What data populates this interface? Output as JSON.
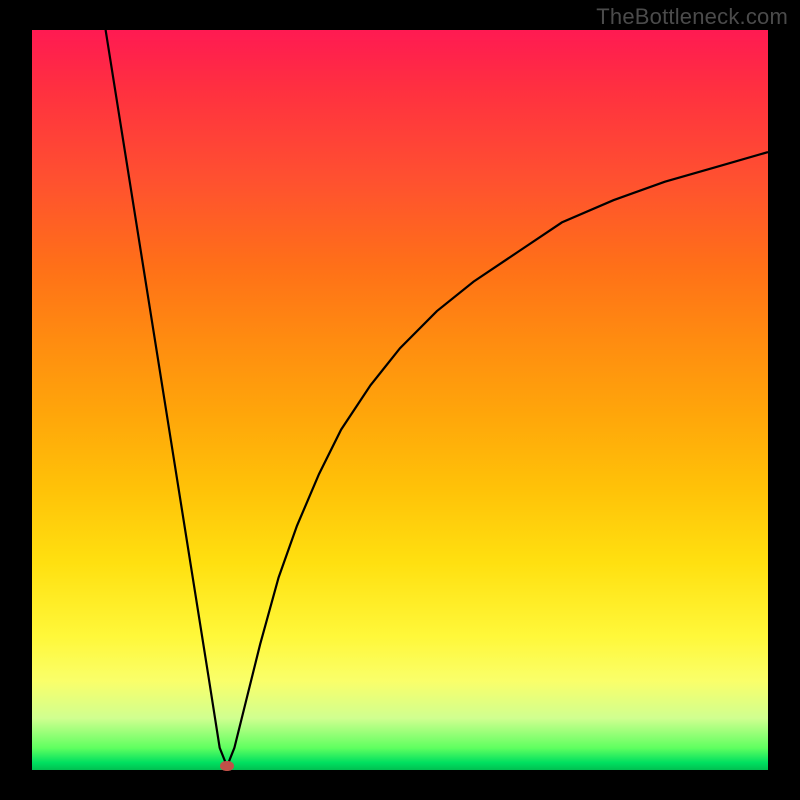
{
  "watermark": "TheBottleneck.com",
  "colors": {
    "frame": "#000000",
    "marker": "#c05048",
    "curve": "#000000"
  },
  "chart_data": {
    "type": "line",
    "title": "",
    "xlabel": "",
    "ylabel": "",
    "xlim": [
      0,
      100
    ],
    "ylim": [
      0,
      100
    ],
    "grid": false,
    "legend": false,
    "marker": {
      "x": 26.5,
      "y": 0.5
    },
    "series": [
      {
        "name": "left",
        "x": [
          10.0,
          12.0,
          14.0,
          16.0,
          18.0,
          20.0,
          22.0,
          24.0,
          25.5,
          26.5
        ],
        "y": [
          100.0,
          87.5,
          75.0,
          62.5,
          50.0,
          37.5,
          25.0,
          12.5,
          3.0,
          0.5
        ]
      },
      {
        "name": "right",
        "x": [
          26.5,
          27.5,
          29.0,
          31.0,
          33.5,
          36.0,
          39.0,
          42.0,
          46.0,
          50.0,
          55.0,
          60.0,
          66.0,
          72.0,
          79.0,
          86.0,
          93.0,
          100.0
        ],
        "y": [
          0.5,
          3.0,
          9.0,
          17.0,
          26.0,
          33.0,
          40.0,
          46.0,
          52.0,
          57.0,
          62.0,
          66.0,
          70.0,
          74.0,
          77.0,
          79.5,
          81.5,
          83.5
        ]
      }
    ]
  }
}
